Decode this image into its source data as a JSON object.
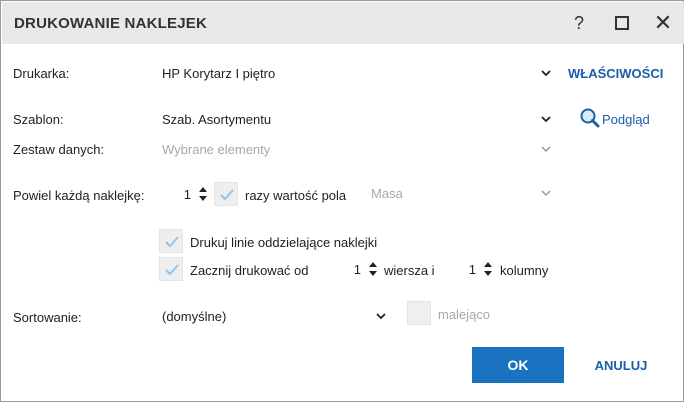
{
  "window": {
    "title": "DRUKOWANIE NAKLEJEK",
    "help_label": "?",
    "close_label": "✕"
  },
  "printer": {
    "label": "Drukarka:",
    "value": "HP Korytarz I piętro",
    "properties_link": "WŁAŚCIWOŚCI"
  },
  "template": {
    "label": "Szablon:",
    "value": "Szab. Asortymentu",
    "preview_link": "Podgląd"
  },
  "dataset": {
    "label": "Zestaw danych:",
    "value": "Wybrane elementy"
  },
  "repeat": {
    "label": "Powiel każdą naklejkę:",
    "count": "1",
    "multiply_label": "razy wartość pola",
    "field_value": "Masa"
  },
  "options": {
    "print_lines_label": "Drukuj linie oddzielające naklejki",
    "start_label": "Zacznij drukować od",
    "row_value": "1",
    "row_label": "wiersza i",
    "col_value": "1",
    "col_label": "kolumny"
  },
  "sorting": {
    "label": "Sortowanie:",
    "value": "(domyślne)",
    "descending_label": "malejąco"
  },
  "buttons": {
    "ok": "OK",
    "cancel": "ANULUJ"
  },
  "colors": {
    "accent": "#1a73c0",
    "link": "#1a5fa8",
    "titlebar": "#e8e8e8"
  }
}
